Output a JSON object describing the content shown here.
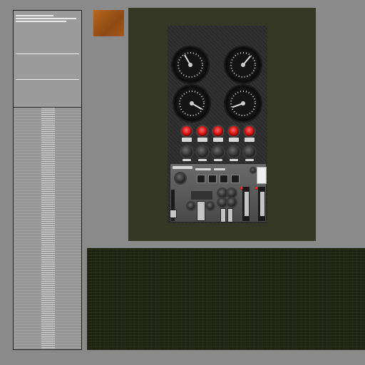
{
  "texture_atlas": {
    "panel": {
      "gauges": [
        {
          "id": "gauge-top-left"
        },
        {
          "id": "gauge-top-right"
        },
        {
          "id": "gauge-mid-left"
        },
        {
          "id": "gauge-mid-right"
        }
      ],
      "warning_lights": 5,
      "rotary_knobs": 5
    },
    "colors": {
      "background": "#8a8a8a",
      "panel_frame": "#363826",
      "rust_swatch": "#a55818",
      "warning_red": "#d51010",
      "mesh": "#1e2212"
    }
  }
}
